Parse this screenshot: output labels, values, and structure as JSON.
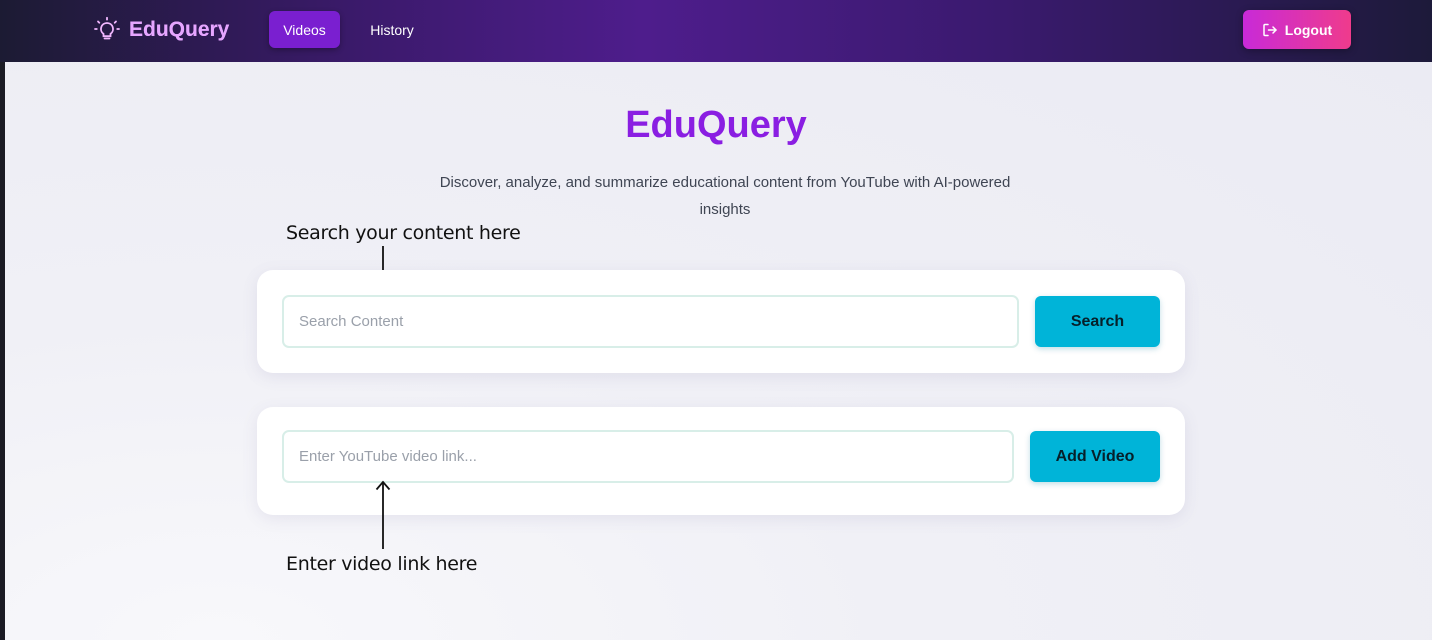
{
  "nav": {
    "brand": "EduQuery",
    "tabs": [
      {
        "label": "Videos",
        "active": true
      },
      {
        "label": "History",
        "active": false
      }
    ],
    "logout_label": "Logout",
    "icons": {
      "brand": "lightbulb-icon",
      "logout": "logout-icon"
    }
  },
  "hero": {
    "title": "EduQuery",
    "subtitle": "Discover, analyze, and summarize educational content from YouTube with AI-powered insights"
  },
  "search": {
    "placeholder": "Search Content",
    "value": "",
    "button_label": "Search"
  },
  "add_video": {
    "placeholder": "Enter YouTube video link...",
    "value": "",
    "button_label": "Add Video"
  },
  "annotations": {
    "search_hint": "Search your content here",
    "video_hint": "Enter video link here"
  },
  "colors": {
    "accent": "#8a1ee2",
    "button": "#00b4d8",
    "logout_start": "#c82ad8",
    "logout_end": "#ef3b8c"
  }
}
